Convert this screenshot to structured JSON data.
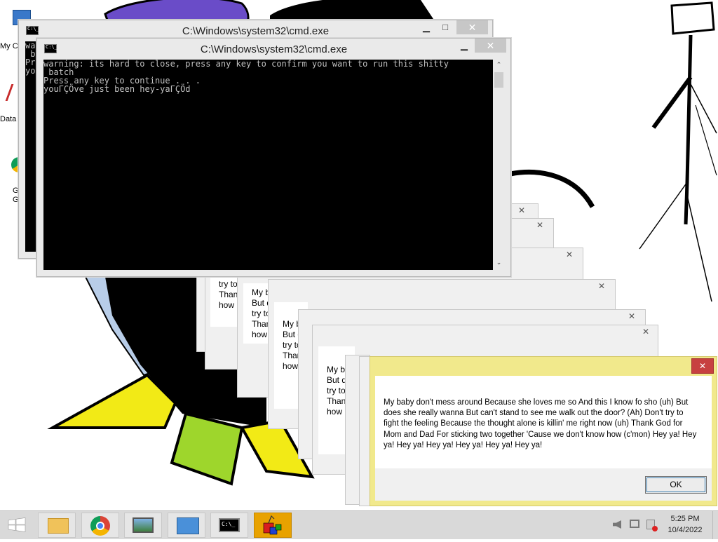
{
  "desktop": {
    "icons": [
      {
        "label": "My C",
        "icon": "computer-icon"
      },
      {
        "label": "Data",
        "icon": "data-tool-icon"
      },
      {
        "label": "G\nG",
        "icon": "chrome-shortcut-icon"
      }
    ]
  },
  "cmd_back": {
    "title": "C:\\Windows\\system32\\cmd.exe",
    "minimize": "▁",
    "maximize": "□",
    "close": "✕",
    "console_left_fragment": "wa\n b\nPr\nyo"
  },
  "cmd_front": {
    "title": "C:\\Windows\\system32\\cmd.exe",
    "minimize": "▁",
    "maximize": "□",
    "close": "✕",
    "console_text": "warning: its hard to close, press any key to confirm you want to run this shitty\n batch\nPress any key to continue . . .\nyouΓÇÖve just been hey-yaΓÇÖd"
  },
  "stacked_boxes": {
    "close": "✕",
    "fragments": [
      {
        "text": "try to\nThan\nhow"
      },
      {
        "text": "My ba\nBut d\ntry to\nThan\nhow"
      },
      {
        "text": "My b\nBut d\ntry to\nThan\nhow"
      },
      {
        "text": "My b\nBut d\ntry to\nThan\nhow"
      }
    ]
  },
  "message_box": {
    "close": "✕",
    "message": "My baby don't mess around Because she loves me so And this I know fo sho (uh) But does she really wanna But can't stand to see me walk out the door? (Ah) Don't try to fight the feeling Because the thought alone is killin' me right now (uh) Thank God for Mom and Dad For sticking two together 'Cause we don't know how (c'mon) Hey ya! Hey ya! Hey ya! Hey ya! Hey ya! Hey ya! Hey ya!",
    "ok_label": "OK"
  },
  "taskbar": {
    "pinned": [
      "start-button",
      "file-explorer",
      "chrome",
      "photo-viewer",
      "control-panel",
      "cmd",
      "active-app"
    ],
    "clock_time": "5:25 PM",
    "clock_date": "10/4/2022",
    "accent": "#e8a200"
  }
}
